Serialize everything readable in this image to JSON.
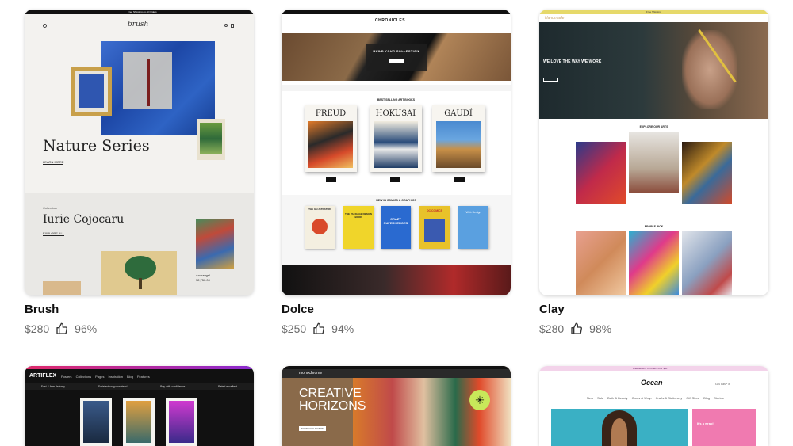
{
  "themes": [
    {
      "name": "Brush",
      "price": "$280",
      "rating": "96%",
      "preview": {
        "announcement": "Free Shipping on all Orders",
        "logo": "brush",
        "hero_title": "Nature Series",
        "hero_link": "LEARN MORE",
        "collection_label": "Collection",
        "collection_title": "Iurie Cojocaru",
        "collection_link": "EXPLORE ALL",
        "product_name": "Archangel",
        "product_price": "$2,750.00"
      }
    },
    {
      "name": "Dolce",
      "price": "$250",
      "rating": "94%",
      "preview": {
        "brand": "CHRONICLES",
        "hero_title": "BUILD YOUR COLLECTION",
        "section_bestselling": "BEST SELLING ART BOOKS",
        "books": [
          "FREUD",
          "HOKUSAI",
          "GAUDÍ"
        ],
        "section_comics": "NEW IN COMICS & GRAPHICS",
        "comics": [
          "THE ILLUSTRATOR",
          "THE PACKAGE DESIGN BOOK",
          "CRAZY SUPERHEROES",
          "DC COMICS",
          "Web Design"
        ]
      }
    },
    {
      "name": "Clay",
      "price": "$280",
      "rating": "98%",
      "preview": {
        "announcement": "Free Shipping",
        "logo": "Handmade",
        "hero_title": "WE LOVE THE WAY WE WORK",
        "section_explore": "EXPLORE OUR ARTS",
        "section_people": "PEOPLE PICK"
      }
    },
    {
      "name": "Artiflex",
      "preview": {
        "logo": "ARTIFLEX",
        "nav": [
          "Posters",
          "Collections",
          "Pages",
          "Inspiration",
          "Blog",
          "Features"
        ],
        "perks": [
          "Fast & free delivery",
          "Satisfaction guaranteed",
          "Buy with confidence",
          "Rated excellent"
        ]
      }
    },
    {
      "name": "Monochrome",
      "preview": {
        "logo": "monochrome",
        "hero_title_1": "CREATIVE",
        "hero_title_2": "HORIZONS",
        "hero_button": "SHOP COLLECTION"
      }
    },
    {
      "name": "Ocean",
      "preview": {
        "announcement": "Free delivery on orders over $50",
        "logo": "Ocean",
        "currency": "GB GBP £",
        "nav": [
          "New",
          "Sale",
          "Bath & Beauty",
          "Cards & Wrap",
          "Crafts & Stationery",
          "Gift Store",
          "Blog",
          "Stories"
        ],
        "promo_title": "It's a wrap!"
      }
    }
  ],
  "colors": {
    "accent_clay": "#e6d96a",
    "brush_blue": "#2a55b8",
    "dolce_dark": "#222222"
  }
}
